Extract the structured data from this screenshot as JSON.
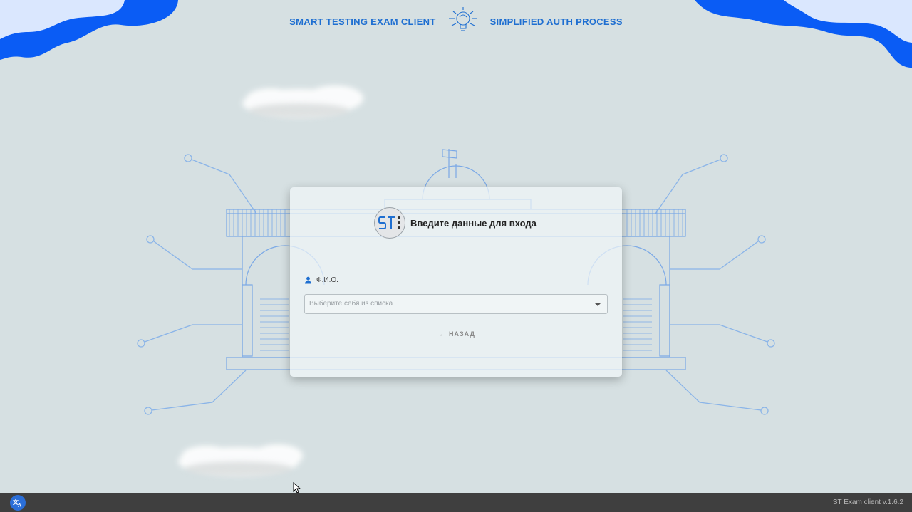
{
  "header": {
    "left_text": "SMART TESTING EXAM CLIENT",
    "right_text": "SIMPLIFIED AUTH PROCESS",
    "logo_icon": "lightbulb-brain-icon"
  },
  "login_card": {
    "avatar_text": "ST",
    "title": "Введите данные для входа",
    "field_label": "Ф.И.О.",
    "field_icon": "user-icon",
    "select_placeholder": "Выберите себя из списка",
    "back_label": "НАЗАД"
  },
  "taskbar": {
    "translate_icon": "translate-icon",
    "version": "ST Exam client v.1.6.2"
  },
  "colors": {
    "accent": "#1f6fd1",
    "wave": "#0a5cf5",
    "background": "#d6e0e2",
    "taskbar": "#3f3f3f"
  }
}
